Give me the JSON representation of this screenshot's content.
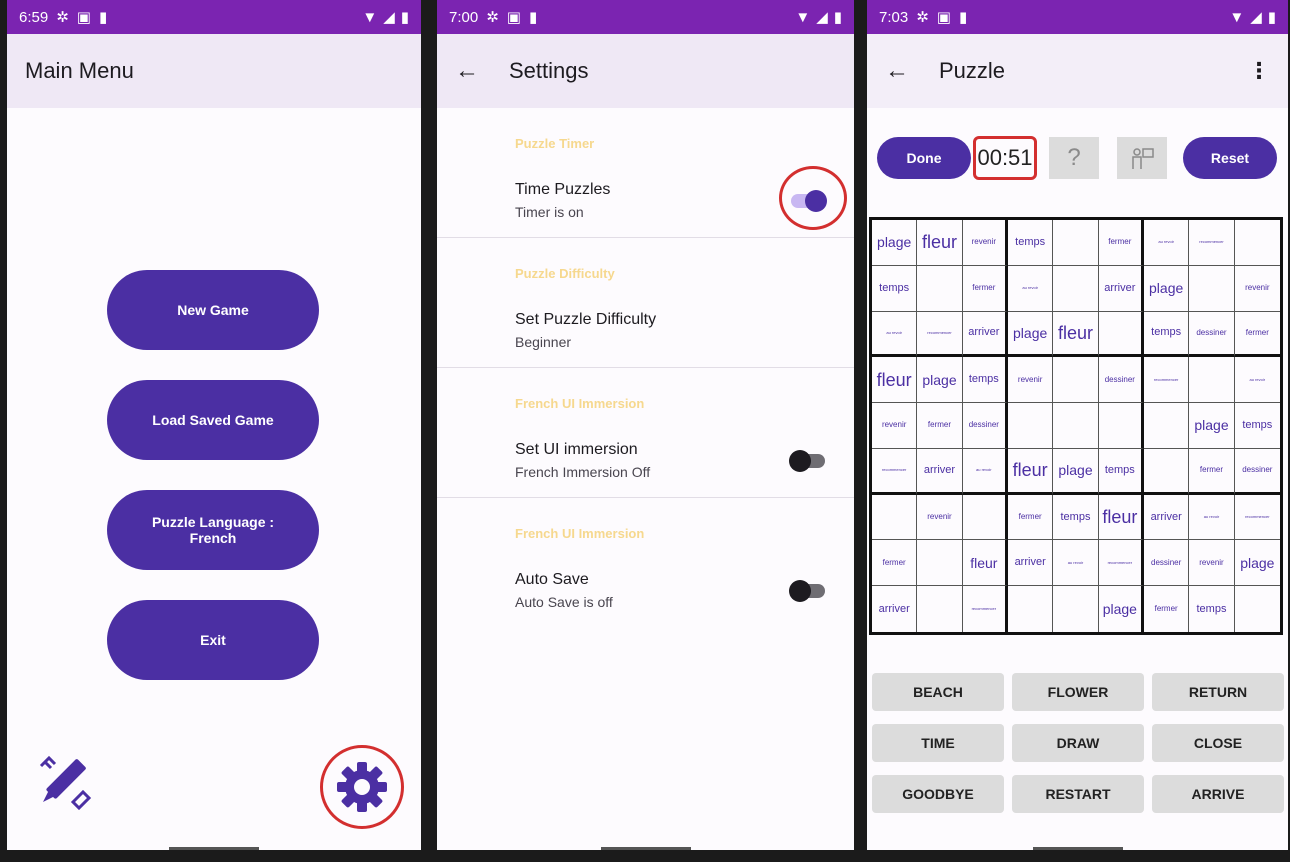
{
  "screens": {
    "main_menu": {
      "status_time": "6:59",
      "title": "Main Menu",
      "buttons": [
        "New Game",
        "Load Saved Game",
        "Puzzle Language : French",
        "Exit"
      ]
    },
    "settings": {
      "status_time": "7:00",
      "title": "Settings",
      "sections": [
        {
          "category": "Puzzle Timer",
          "name": "Time Puzzles",
          "subtitle": "Timer is on",
          "enabled": true
        },
        {
          "category": "Puzzle Difficulty",
          "name": "Set Puzzle Difficulty",
          "subtitle": "Beginner"
        },
        {
          "category": "French UI Immersion",
          "name": "Set UI immersion",
          "subtitle": "French Immersion Off",
          "enabled": false
        },
        {
          "category": "French UI Immersion",
          "name": "Auto Save",
          "subtitle": "Auto Save is off",
          "enabled": false
        }
      ]
    },
    "puzzle": {
      "status_time": "7:03",
      "title": "Puzzle",
      "done_label": "Done",
      "timer": "00:51",
      "reset_label": "Reset",
      "grid": [
        [
          "plage",
          "fleur",
          "revenir",
          "temps",
          "",
          "fermer",
          "au revoir",
          "recommencer",
          ""
        ],
        [
          "temps",
          "",
          "fermer",
          "au revoir",
          "",
          "arriver",
          "plage",
          "",
          "revenir"
        ],
        [
          "au revoir",
          "recommencer",
          "arriver",
          "plage",
          "fleur",
          "",
          "temps",
          "dessiner",
          "fermer"
        ],
        [
          "fleur",
          "plage",
          "temps",
          "revenir",
          "",
          "dessiner",
          "recommencer",
          "",
          "au revoir"
        ],
        [
          "revenir",
          "fermer",
          "dessiner",
          "",
          "",
          "",
          "",
          "plage",
          "temps"
        ],
        [
          "recommencer",
          "arriver",
          "au revoir",
          "fleur",
          "plage",
          "temps",
          "",
          "fermer",
          "dessiner"
        ],
        [
          "",
          "revenir",
          "",
          "fermer",
          "temps",
          "fleur",
          "arriver",
          "au revoir",
          "recommencer"
        ],
        [
          "fermer",
          "",
          "fleur",
          "arriver",
          "au revoir",
          "recommencer",
          "dessiner",
          "revenir",
          "plage"
        ],
        [
          "arriver",
          "",
          "recommencer",
          "",
          "",
          "plage",
          "fermer",
          "temps",
          ""
        ]
      ],
      "word_buttons": [
        "BEACH",
        "FLOWER",
        "RETURN",
        "TIME",
        "DRAW",
        "CLOSE",
        "GOODBYE",
        "RESTART",
        "ARRIVE"
      ]
    }
  },
  "colors": {
    "status_bar": "#7b24b1",
    "primary": "#4b2fa3",
    "app_bar": "#efe8f5",
    "highlight_ring": "#d32f2f",
    "category_text": "#f6d88e"
  }
}
